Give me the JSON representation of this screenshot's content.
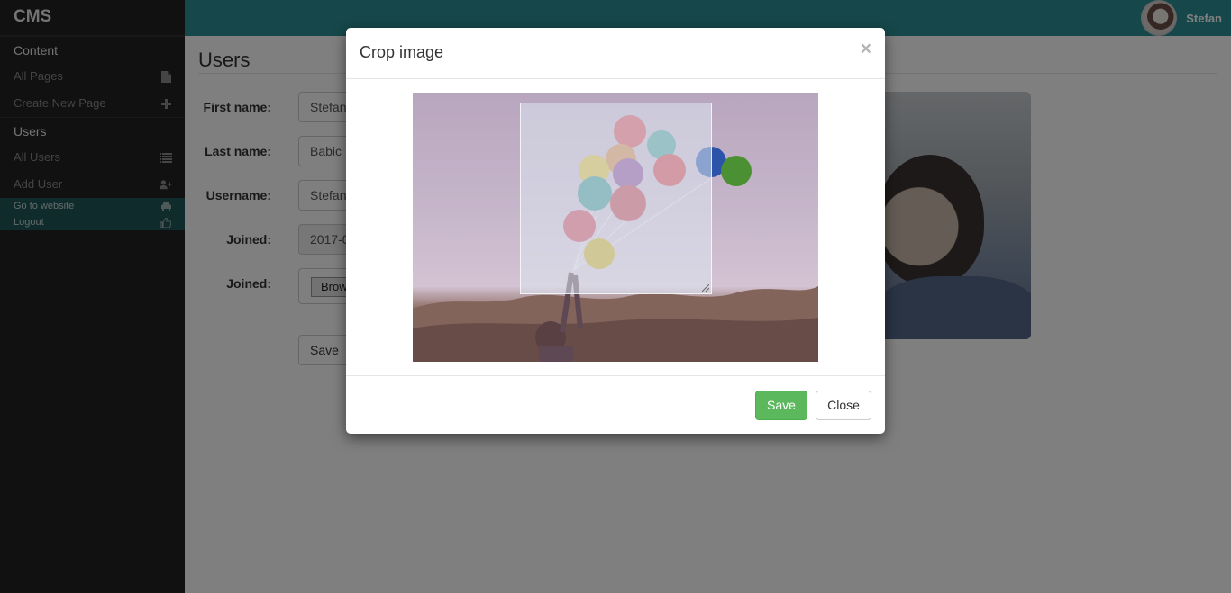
{
  "sidebar": {
    "brand": "CMS",
    "sections": [
      {
        "title": "Content",
        "items": [
          {
            "label": "All Pages",
            "icon": "file-icon"
          },
          {
            "label": "Create New Page",
            "icon": "plus-icon"
          }
        ]
      },
      {
        "title": "Users",
        "items": [
          {
            "label": "All Users",
            "icon": "list-icon"
          },
          {
            "label": "Add User",
            "icon": "user-plus-icon"
          }
        ]
      }
    ],
    "footer_items": [
      {
        "label": "Go to website",
        "icon": "car-icon"
      },
      {
        "label": "Logout",
        "icon": "thumbs-up-icon"
      }
    ]
  },
  "topbar": {
    "username": "Stefan"
  },
  "main": {
    "title": "Users",
    "form": {
      "first_name_label": "First name:",
      "first_name_value": "Stefan",
      "last_name_label": "Last name:",
      "last_name_value": "Babic",
      "username_label": "Username:",
      "username_value": "Stefan",
      "joined_label": "Joined:",
      "joined_value": "2017-0",
      "joined2_label": "Joined:",
      "browse_label": "Brow",
      "save_label": "Save"
    }
  },
  "modal": {
    "title": "Crop image",
    "close_symbol": "×",
    "save_label": "Save",
    "close_label": "Close"
  },
  "colors": {
    "topbar": "#2c8f94",
    "sidebar": "#222222",
    "save_button": "#5cb85c"
  }
}
